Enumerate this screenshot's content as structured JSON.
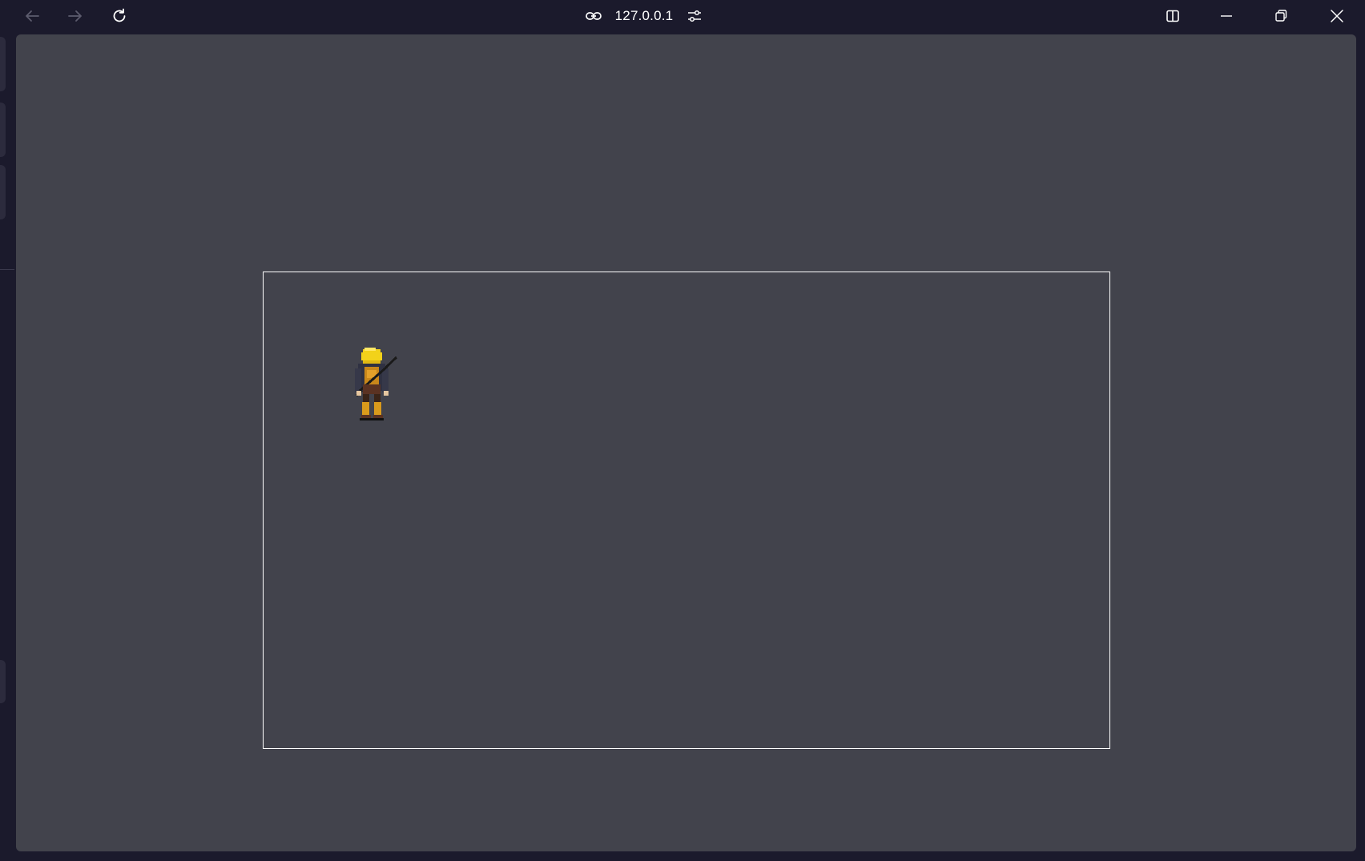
{
  "browser": {
    "address": "127.0.0.1",
    "icons": {
      "back": "arrow-left-icon",
      "forward": "arrow-right-icon",
      "reload": "reload-icon",
      "link": "link-icon",
      "site_settings": "sliders-icon",
      "split_view": "split-view-icon",
      "minimize": "minimize-icon",
      "restore": "restore-icon",
      "close": "close-icon"
    },
    "colors": {
      "chrome": "#1b1a2c",
      "page_background": "#42434c",
      "canvas_border": "#ffffff"
    }
  },
  "game": {
    "character": "player-sprite",
    "character_colors": {
      "hair": "#f2d21a",
      "tunic": "#c9871a",
      "cloak": "#2f3142",
      "boots": "#d99a1c",
      "staff": "#1a1a1a"
    }
  }
}
